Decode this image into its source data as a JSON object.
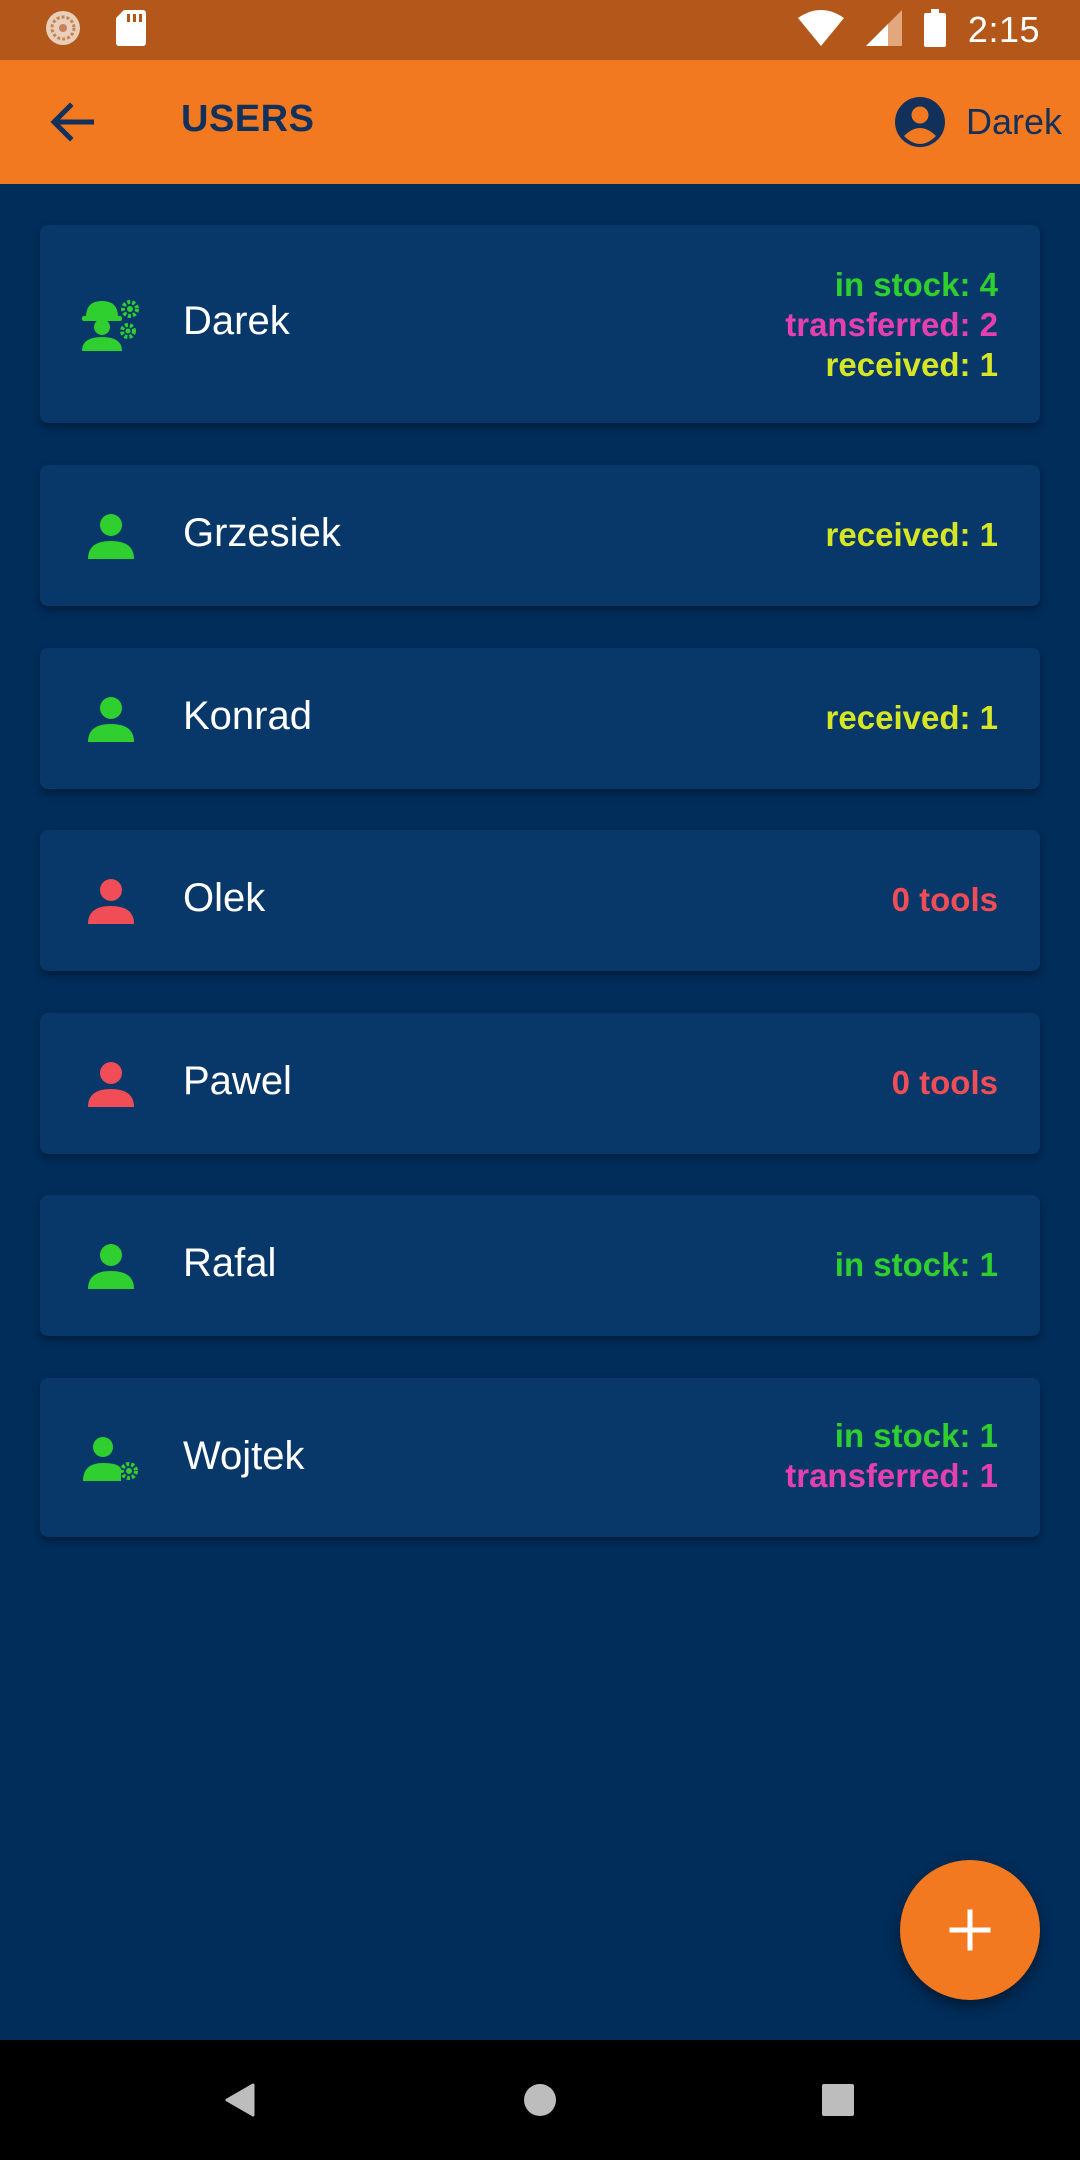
{
  "status_bar": {
    "time": "2:15",
    "icons": [
      "notification-icon",
      "sd-card-icon",
      "wifi-icon",
      "signal-icon",
      "battery-icon"
    ]
  },
  "app_bar": {
    "title": "USERS",
    "account_name": "Darek"
  },
  "colors": {
    "background": "#012d5a",
    "card": "#073869",
    "accent": "#f37921",
    "in_stock": "#2ecf2e",
    "transferred": "#e640b0",
    "received": "#d7e624",
    "no_tools": "#f04d56"
  },
  "users": [
    {
      "name": "Darek",
      "icon": "engineer-settings-icon",
      "icon_color": "#2ecf2e",
      "stats": [
        {
          "text": "in stock: 4",
          "color": "#2ecf2e"
        },
        {
          "text": "transferred: 2",
          "color": "#e640b0"
        },
        {
          "text": "received: 1",
          "color": "#d7e624"
        }
      ]
    },
    {
      "name": "Grzesiek",
      "icon": "person-icon",
      "icon_color": "#2ecf2e",
      "stats": [
        {
          "text": "received: 1",
          "color": "#d7e624"
        }
      ]
    },
    {
      "name": "Konrad",
      "icon": "person-icon",
      "icon_color": "#2ecf2e",
      "stats": [
        {
          "text": "received: 1",
          "color": "#d7e624"
        }
      ]
    },
    {
      "name": "Olek",
      "icon": "person-icon",
      "icon_color": "#f04d56",
      "stats": [
        {
          "text": "0 tools",
          "color": "#f04d56"
        }
      ]
    },
    {
      "name": "Pawel",
      "icon": "person-icon",
      "icon_color": "#f04d56",
      "stats": [
        {
          "text": "0 tools",
          "color": "#f04d56"
        }
      ]
    },
    {
      "name": "Rafal",
      "icon": "person-icon",
      "icon_color": "#2ecf2e",
      "stats": [
        {
          "text": "in stock: 1",
          "color": "#2ecf2e"
        }
      ]
    },
    {
      "name": "Wojtek",
      "icon": "person-settings-icon",
      "icon_color": "#2ecf2e",
      "stats": [
        {
          "text": "in stock: 1",
          "color": "#2ecf2e"
        },
        {
          "text": "transferred: 1",
          "color": "#e640b0"
        }
      ]
    }
  ],
  "fab": {
    "icon": "plus-icon"
  },
  "nav_bar": {
    "icons": [
      "back-triangle-icon",
      "home-circle-icon",
      "recents-square-icon"
    ]
  }
}
